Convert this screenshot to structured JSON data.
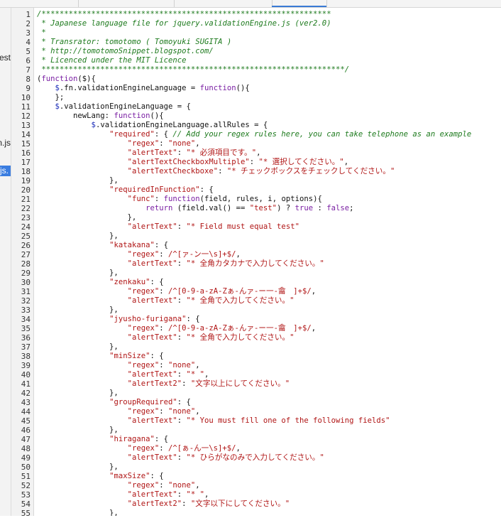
{
  "sidebar": {
    "items": [
      {
        "label": "test",
        "active": false
      },
      {
        "label": "n.js",
        "active": false
      },
      {
        "label": ".js",
        "active": true
      }
    ]
  },
  "editor": {
    "lines": [
      [
        [
          "cm",
          "/****************************************************************"
        ]
      ],
      [
        [
          "cm",
          " * Japanese language file for jquery.validationEngine.js (ver2.0)"
        ]
      ],
      [
        [
          "cm",
          " *"
        ]
      ],
      [
        [
          "cm",
          " * Transrator: tomotomo ( Tomoyuki SUGITA )"
        ]
      ],
      [
        [
          "cm",
          " * http://tomotomoSnippet.blogspot.com/"
        ]
      ],
      [
        [
          "cm",
          " * Licenced under the MIT Licence"
        ]
      ],
      [
        [
          "cm",
          " *******************************************************************/"
        ]
      ],
      [
        [
          "pn",
          "("
        ],
        [
          "kw",
          "function"
        ],
        [
          "pn",
          "($){"
        ]
      ],
      [
        [
          "pn",
          "    "
        ],
        [
          "id",
          "$"
        ],
        [
          "pn",
          ".fn.validationEngineLanguage = "
        ],
        [
          "kw",
          "function"
        ],
        [
          "pn",
          "(){"
        ]
      ],
      [
        [
          "pn",
          "    };"
        ]
      ],
      [
        [
          "pn",
          "    "
        ],
        [
          "id",
          "$"
        ],
        [
          "pn",
          ".validationEngineLanguage = {"
        ]
      ],
      [
        [
          "pn",
          "        newLang: "
        ],
        [
          "kw",
          "function"
        ],
        [
          "pn",
          "(){"
        ]
      ],
      [
        [
          "pn",
          "            "
        ],
        [
          "id",
          "$"
        ],
        [
          "pn",
          ".validationEngineLanguage.allRules = {"
        ]
      ],
      [
        [
          "pn",
          "                "
        ],
        [
          "str",
          "\"required\""
        ],
        [
          "pn",
          ": { "
        ],
        [
          "cm",
          "// Add your regex rules here, you can take telephone as an example"
        ]
      ],
      [
        [
          "pn",
          "                    "
        ],
        [
          "str",
          "\"regex\""
        ],
        [
          "pn",
          ": "
        ],
        [
          "str",
          "\"none\""
        ],
        [
          "pn",
          ","
        ]
      ],
      [
        [
          "pn",
          "                    "
        ],
        [
          "str",
          "\"alertText\""
        ],
        [
          "pn",
          ": "
        ],
        [
          "str",
          "\"* 必須項目です。\""
        ],
        [
          "pn",
          ","
        ]
      ],
      [
        [
          "pn",
          "                    "
        ],
        [
          "str",
          "\"alertTextCheckboxMultiple\""
        ],
        [
          "pn",
          ": "
        ],
        [
          "str",
          "\"* 選択してください。\""
        ],
        [
          "pn",
          ","
        ]
      ],
      [
        [
          "pn",
          "                    "
        ],
        [
          "str",
          "\"alertTextCheckboxe\""
        ],
        [
          "pn",
          ": "
        ],
        [
          "str",
          "\"* チェックボックスをチェックしてください。\""
        ]
      ],
      [
        [
          "pn",
          "                },"
        ]
      ],
      [
        [
          "pn",
          "                "
        ],
        [
          "str",
          "\"requiredInFunction\""
        ],
        [
          "pn",
          ": {"
        ]
      ],
      [
        [
          "pn",
          "                    "
        ],
        [
          "str",
          "\"func\""
        ],
        [
          "pn",
          ": "
        ],
        [
          "kw",
          "function"
        ],
        [
          "pn",
          "(field, rules, i, options){"
        ]
      ],
      [
        [
          "pn",
          "                        "
        ],
        [
          "kw",
          "return"
        ],
        [
          "pn",
          " (field.val() == "
        ],
        [
          "str",
          "\"test\""
        ],
        [
          "pn",
          ") ? "
        ],
        [
          "kw",
          "true"
        ],
        [
          "pn",
          " : "
        ],
        [
          "kw",
          "false"
        ],
        [
          "pn",
          ";"
        ]
      ],
      [
        [
          "pn",
          "                    },"
        ]
      ],
      [
        [
          "pn",
          "                    "
        ],
        [
          "str",
          "\"alertText\""
        ],
        [
          "pn",
          ": "
        ],
        [
          "str",
          "\"* Field must equal test\""
        ]
      ],
      [
        [
          "pn",
          "                },"
        ]
      ],
      [
        [
          "pn",
          "                "
        ],
        [
          "str",
          "\"katakana\""
        ],
        [
          "pn",
          ": {"
        ]
      ],
      [
        [
          "pn",
          "                    "
        ],
        [
          "str",
          "\"regex\""
        ],
        [
          "pn",
          ": "
        ],
        [
          "str",
          "/^[ァ-ン一\\s]+$/"
        ],
        [
          "pn",
          ","
        ]
      ],
      [
        [
          "pn",
          "                    "
        ],
        [
          "str",
          "\"alertText\""
        ],
        [
          "pn",
          ": "
        ],
        [
          "str",
          "\"* 全角カタカナで入力してください。\""
        ]
      ],
      [
        [
          "pn",
          "                },"
        ]
      ],
      [
        [
          "pn",
          "                "
        ],
        [
          "str",
          "\"zenkaku\""
        ],
        [
          "pn",
          ": {"
        ]
      ],
      [
        [
          "pn",
          "                    "
        ],
        [
          "str",
          "\"regex\""
        ],
        [
          "pn",
          ": "
        ],
        [
          "str",
          "/^[0-9-a-zA-Zぁ-んァ-ー一-龠　]+$/"
        ],
        [
          "pn",
          ","
        ]
      ],
      [
        [
          "pn",
          "                    "
        ],
        [
          "str",
          "\"alertText\""
        ],
        [
          "pn",
          ": "
        ],
        [
          "str",
          "\"* 全角で入力してください。\""
        ]
      ],
      [
        [
          "pn",
          "                },"
        ]
      ],
      [
        [
          "pn",
          "                "
        ],
        [
          "str",
          "\"jyusho-furigana\""
        ],
        [
          "pn",
          ": {"
        ]
      ],
      [
        [
          "pn",
          "                    "
        ],
        [
          "str",
          "\"regex\""
        ],
        [
          "pn",
          ": "
        ],
        [
          "str",
          "/^[0-9-a-zA-Zぁ-んァ-ー一-龠　]+$/"
        ],
        [
          "pn",
          ","
        ]
      ],
      [
        [
          "pn",
          "                    "
        ],
        [
          "str",
          "\"alertText\""
        ],
        [
          "pn",
          ": "
        ],
        [
          "str",
          "\"* 全角で入力してください。\""
        ]
      ],
      [
        [
          "pn",
          "                },"
        ]
      ],
      [
        [
          "pn",
          "                "
        ],
        [
          "str",
          "\"minSize\""
        ],
        [
          "pn",
          ": {"
        ]
      ],
      [
        [
          "pn",
          "                    "
        ],
        [
          "str",
          "\"regex\""
        ],
        [
          "pn",
          ": "
        ],
        [
          "str",
          "\"none\""
        ],
        [
          "pn",
          ","
        ]
      ],
      [
        [
          "pn",
          "                    "
        ],
        [
          "str",
          "\"alertText\""
        ],
        [
          "pn",
          ": "
        ],
        [
          "str",
          "\"* \""
        ],
        [
          "pn",
          ","
        ]
      ],
      [
        [
          "pn",
          "                    "
        ],
        [
          "str",
          "\"alertText2\""
        ],
        [
          "pn",
          ": "
        ],
        [
          "str",
          "\"文字以上にしてください。\""
        ]
      ],
      [
        [
          "pn",
          "                },"
        ]
      ],
      [
        [
          "pn",
          "                "
        ],
        [
          "str",
          "\"groupRequired\""
        ],
        [
          "pn",
          ": {"
        ]
      ],
      [
        [
          "pn",
          "                    "
        ],
        [
          "str",
          "\"regex\""
        ],
        [
          "pn",
          ": "
        ],
        [
          "str",
          "\"none\""
        ],
        [
          "pn",
          ","
        ]
      ],
      [
        [
          "pn",
          "                    "
        ],
        [
          "str",
          "\"alertText\""
        ],
        [
          "pn",
          ": "
        ],
        [
          "str",
          "\"* You must fill one of the following fields\""
        ]
      ],
      [
        [
          "pn",
          "                },"
        ]
      ],
      [
        [
          "pn",
          "                "
        ],
        [
          "str",
          "\"hiragana\""
        ],
        [
          "pn",
          ": {"
        ]
      ],
      [
        [
          "pn",
          "                    "
        ],
        [
          "str",
          "\"regex\""
        ],
        [
          "pn",
          ": "
        ],
        [
          "str",
          "/^[ぁ-ん一\\s]+$/"
        ],
        [
          "pn",
          ","
        ]
      ],
      [
        [
          "pn",
          "                    "
        ],
        [
          "str",
          "\"alertText\""
        ],
        [
          "pn",
          ": "
        ],
        [
          "str",
          "\"* ひらがなのみで入力してください。\""
        ]
      ],
      [
        [
          "pn",
          "                },"
        ]
      ],
      [
        [
          "pn",
          "                "
        ],
        [
          "str",
          "\"maxSize\""
        ],
        [
          "pn",
          ": {"
        ]
      ],
      [
        [
          "pn",
          "                    "
        ],
        [
          "str",
          "\"regex\""
        ],
        [
          "pn",
          ": "
        ],
        [
          "str",
          "\"none\""
        ],
        [
          "pn",
          ","
        ]
      ],
      [
        [
          "pn",
          "                    "
        ],
        [
          "str",
          "\"alertText\""
        ],
        [
          "pn",
          ": "
        ],
        [
          "str",
          "\"* \""
        ],
        [
          "pn",
          ","
        ]
      ],
      [
        [
          "pn",
          "                    "
        ],
        [
          "str",
          "\"alertText2\""
        ],
        [
          "pn",
          ": "
        ],
        [
          "str",
          "\"文字以下にしてください。\""
        ]
      ],
      [
        [
          "pn",
          "                },"
        ]
      ]
    ]
  }
}
